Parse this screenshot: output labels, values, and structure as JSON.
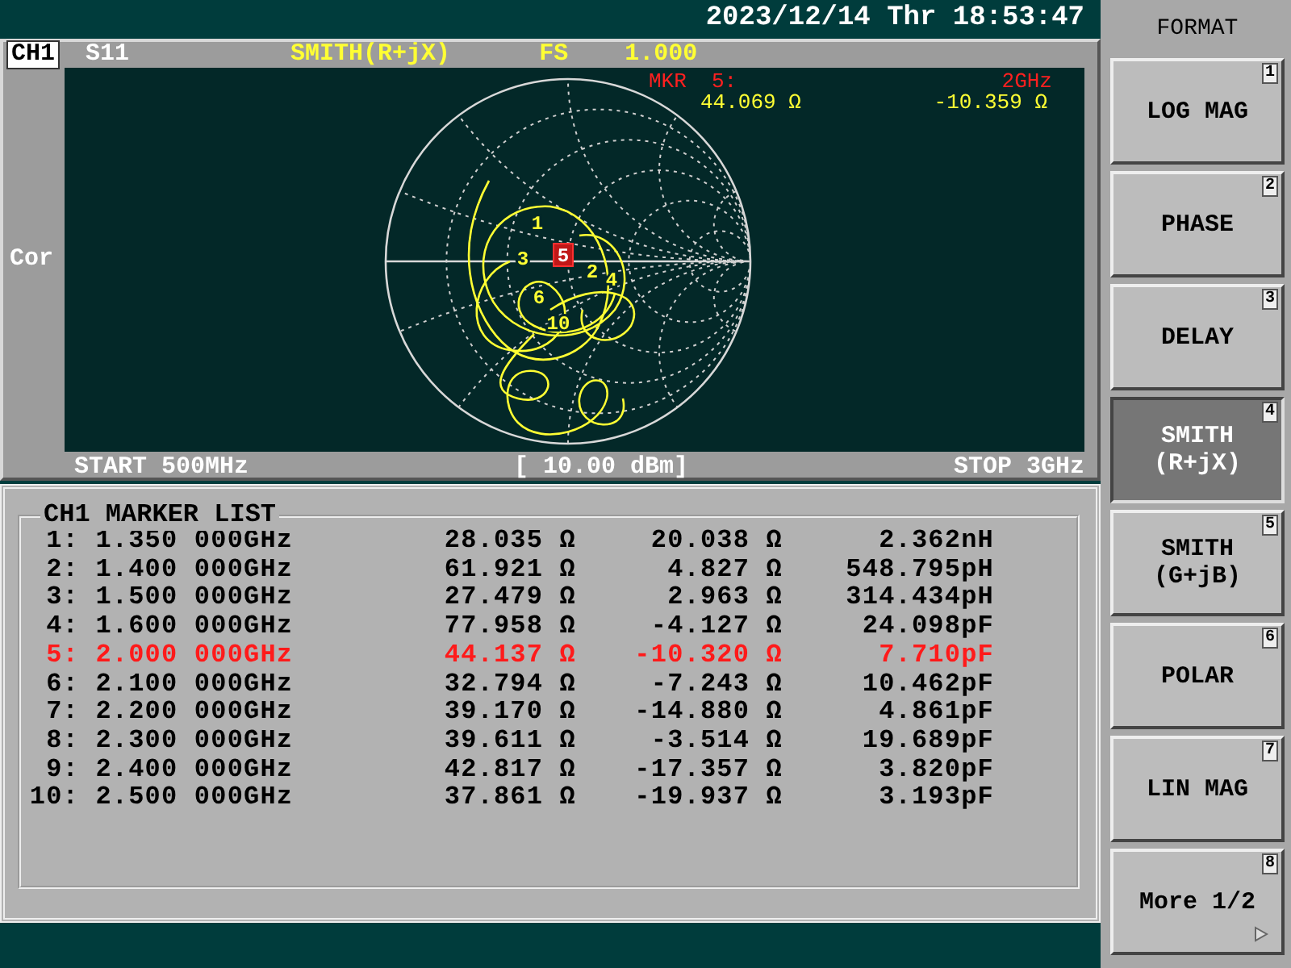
{
  "status_bar": {
    "datetime": "2023/12/14 Thr 18:53:47"
  },
  "channel": {
    "label": "CH1",
    "parameter": "S11",
    "format": "SMITH(R+jX)",
    "scale": "FS",
    "scale_value": "1.000",
    "side_label": "Cor",
    "marker_readout": {
      "label": "MKR  5:",
      "frequency": "2GHz",
      "real": "44.069 Ω",
      "imag": "-10.359 Ω"
    },
    "trace_markers": [
      {
        "label": "1",
        "active": false
      },
      {
        "label": "2",
        "active": false
      },
      {
        "label": "3",
        "active": false
      },
      {
        "label": "4",
        "active": false
      },
      {
        "label": "5",
        "active": true
      },
      {
        "label": "6",
        "active": false
      },
      {
        "label": "10",
        "active": false
      }
    ],
    "start": "START 500MHz",
    "power": "[ 10.00 dBm]",
    "stop": "STOP 3GHz"
  },
  "marker_list": {
    "title": "CH1 MARKER LIST",
    "rows": [
      {
        "marker": "1:",
        "frequency": "1.350 000GHz",
        "resistance": "28.035 Ω",
        "reactance": "20.038 Ω",
        "equivalent": "2.362nH",
        "selected": false
      },
      {
        "marker": "2:",
        "frequency": "1.400 000GHz",
        "resistance": "61.921 Ω",
        "reactance": "4.827 Ω",
        "equivalent": "548.795pH",
        "selected": false
      },
      {
        "marker": "3:",
        "frequency": "1.500 000GHz",
        "resistance": "27.479 Ω",
        "reactance": "2.963 Ω",
        "equivalent": "314.434pH",
        "selected": false
      },
      {
        "marker": "4:",
        "frequency": "1.600 000GHz",
        "resistance": "77.958 Ω",
        "reactance": "-4.127 Ω",
        "equivalent": "24.098pF",
        "selected": false
      },
      {
        "marker": "5:",
        "frequency": "2.000 000GHz",
        "resistance": "44.137 Ω",
        "reactance": "-10.320 Ω",
        "equivalent": "7.710pF",
        "selected": true
      },
      {
        "marker": "6:",
        "frequency": "2.100 000GHz",
        "resistance": "32.794 Ω",
        "reactance": "-7.243 Ω",
        "equivalent": "10.462pF",
        "selected": false
      },
      {
        "marker": "7:",
        "frequency": "2.200 000GHz",
        "resistance": "39.170 Ω",
        "reactance": "-14.880 Ω",
        "equivalent": "4.861pF",
        "selected": false
      },
      {
        "marker": "8:",
        "frequency": "2.300 000GHz",
        "resistance": "39.611 Ω",
        "reactance": "-3.514 Ω",
        "equivalent": "19.689pF",
        "selected": false
      },
      {
        "marker": "9:",
        "frequency": "2.400 000GHz",
        "resistance": "42.817 Ω",
        "reactance": "-17.357 Ω",
        "equivalent": "3.820pF",
        "selected": false
      },
      {
        "marker": "10:",
        "frequency": "2.500 000GHz",
        "resistance": "37.861 Ω",
        "reactance": "-19.937 Ω",
        "equivalent": "3.193pF",
        "selected": false
      }
    ]
  },
  "softkeys": {
    "title": "FORMAT",
    "keys": [
      {
        "label": "LOG MAG",
        "number": "1",
        "selected": false
      },
      {
        "label": "PHASE",
        "number": "2",
        "selected": false
      },
      {
        "label": "DELAY",
        "number": "3",
        "selected": false
      },
      {
        "label": "SMITH\n(R+jX)",
        "number": "4",
        "selected": true
      },
      {
        "label": "SMITH\n(G+jB)",
        "number": "5",
        "selected": false
      },
      {
        "label": "POLAR",
        "number": "6",
        "selected": false
      },
      {
        "label": "LIN MAG",
        "number": "7",
        "selected": false
      },
      {
        "label": "More 1/2",
        "number": "8",
        "selected": false,
        "more": true
      }
    ]
  }
}
